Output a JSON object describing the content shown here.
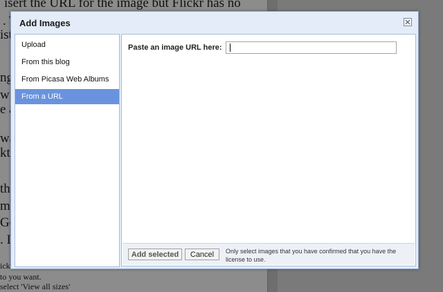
{
  "background": {
    "lines": [
      "isert the URL for the image but Flickr has no",
      ". T",
      "istr",
      "ng",
      " w",
      "e a",
      "wa",
      "kt",
      "th",
      "m",
      "Go",
      ". It",
      "ickr",
      "to you want.",
      "select 'View all sizes'"
    ]
  },
  "dialog": {
    "title": "Add Images",
    "close_icon": "close-x-icon",
    "sidebar": {
      "items": [
        {
          "label": "Upload"
        },
        {
          "label": "From this blog"
        },
        {
          "label": "From Picasa Web Albums"
        },
        {
          "label": "From a URL"
        }
      ],
      "selected_index": 3,
      "selected_color": "#6993de"
    },
    "url": {
      "label": "Paste an image URL here:",
      "value": "",
      "placeholder": ""
    },
    "footer": {
      "add_selected_label": "Add selected",
      "cancel_label": "Cancel",
      "note": "Only select images that you have confirmed that you have the license to use."
    }
  }
}
